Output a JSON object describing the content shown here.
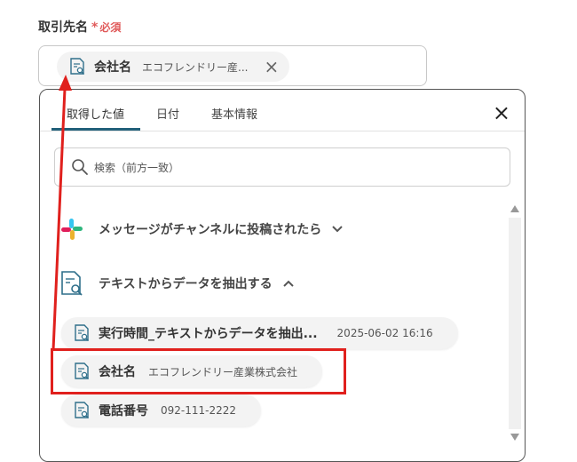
{
  "field": {
    "label": "取引先名",
    "required_star": "*",
    "required_text": "必須"
  },
  "selected_chip": {
    "icon": "document-search-icon",
    "name": "会社名",
    "value": "エコフレンドリー産...",
    "close_icon": "×"
  },
  "tabs": [
    {
      "label": "取得した値",
      "active": true
    },
    {
      "label": "日付",
      "active": false
    },
    {
      "label": "基本情報",
      "active": false
    }
  ],
  "panel_close": "×",
  "search": {
    "placeholder": "検索（前方一致）",
    "value": ""
  },
  "groups": [
    {
      "icon": "slack-icon",
      "label": "メッセージがチャンネルに投稿されたら",
      "expanded": false
    },
    {
      "icon": "document-search-icon",
      "label": "テキストからデータを抽出する",
      "expanded": true
    }
  ],
  "items": [
    {
      "icon": "document-search-icon",
      "name": "実行時間_テキストからデータを抽出...",
      "value": "2025-06-02 16:16"
    },
    {
      "icon": "document-search-icon",
      "name": "会社名",
      "value": "エコフレンドリー産業株式会社"
    },
    {
      "icon": "document-search-icon",
      "name": "電話番号",
      "value": "092-111-2222"
    }
  ],
  "colors": {
    "accent": "#22607a",
    "required": "#e05a5a",
    "annotation": "#e0201d",
    "chip_bg": "#f3f3f3"
  }
}
